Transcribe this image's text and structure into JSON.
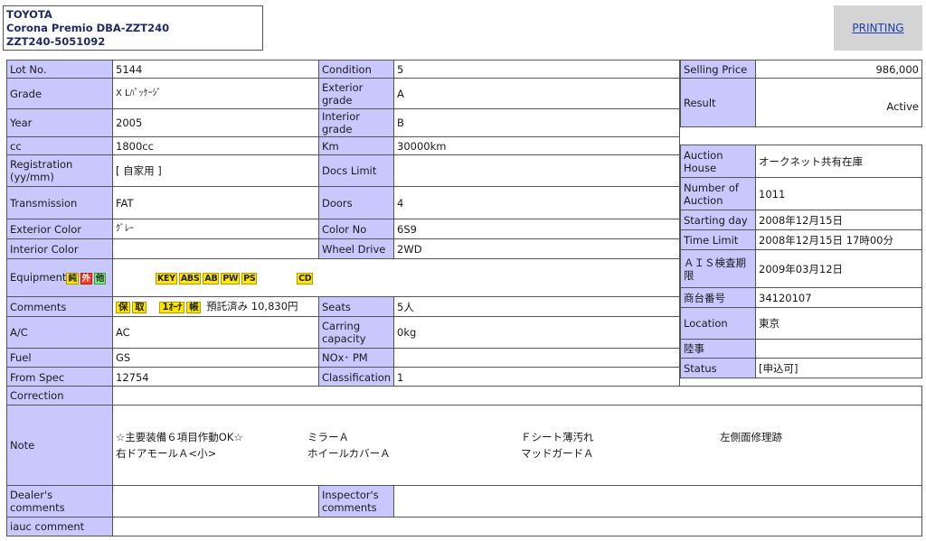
{
  "header": {
    "make": "TOYOTA",
    "model": "Corona Premio DBA-ZZT240",
    "chassis": "ZZT240-5051092",
    "print_label": "PRINTING"
  },
  "vehicle": {
    "lot_no": {
      "label": "Lot No.",
      "value": "5144"
    },
    "grade": {
      "label": "Grade",
      "value": "X Lﾊﾟｯｹｰｼﾞ"
    },
    "year": {
      "label": "Year",
      "value": "2005"
    },
    "cc": {
      "label": "cc",
      "value": "1800cc"
    },
    "registration": {
      "label": "Registration (yy/mm)",
      "value": "[ 自家用 ]"
    },
    "transmission": {
      "label": "Transmission",
      "value": "FAT"
    },
    "exterior_color": {
      "label": "Exterior Color",
      "value": "ｸﾞﾚｰ"
    },
    "interior_color": {
      "label": "Interior Color",
      "value": ""
    },
    "equipment": {
      "label": "Equipment",
      "type_tags": [
        "純",
        "外",
        "他"
      ],
      "tags": [
        "KEY",
        "ABS",
        "AB",
        "PW",
        "PS"
      ],
      "extra_tag": "CD"
    },
    "comments": {
      "label": "Comments",
      "tags": [
        "保",
        "取",
        "1ｵｰﾅ",
        "帳"
      ],
      "text": "預託済み 10,830円"
    },
    "ac": {
      "label": "A/C",
      "value": "AC"
    },
    "fuel": {
      "label": "Fuel",
      "value": "GS"
    },
    "from_spec": {
      "label": "From Spec",
      "value": "12754"
    },
    "condition": {
      "label": "Condition",
      "value": "5"
    },
    "exterior_grade": {
      "label": "Exterior grade",
      "value": "A"
    },
    "interior_grade": {
      "label": "Interior grade",
      "value": "B"
    },
    "km": {
      "label": "Km",
      "value": "30000km"
    },
    "docs_limit": {
      "label": "Docs Limit",
      "value": ""
    },
    "doors": {
      "label": "Doors",
      "value": "4"
    },
    "color_no": {
      "label": "Color No",
      "value": "6S9"
    },
    "wheel_drive": {
      "label": "Wheel Drive",
      "value": "2WD"
    },
    "seats": {
      "label": "Seats",
      "value": "5人"
    },
    "carrying_capacity": {
      "label": "Carring capacity",
      "value": "0kg"
    },
    "nox_pm": {
      "label": "NOx･ PM",
      "value": ""
    },
    "classification": {
      "label": "Classification",
      "value": "1"
    }
  },
  "price": {
    "selling_price": {
      "label": "Selling Price",
      "value": "986,000"
    },
    "result": {
      "label": "Result",
      "value": "Active"
    }
  },
  "auction": {
    "house": {
      "label": "Auction House",
      "value": "オークネット共有在庫"
    },
    "number": {
      "label": "Number of Auction",
      "value": "1011"
    },
    "starting_day": {
      "label": "Starting day",
      "value": "2008年12月15日"
    },
    "time_limit": {
      "label": "Time Limit",
      "value": "2008年12月15日 17時00分"
    },
    "ais": {
      "label": "ＡＩＳ検査期限",
      "value": "2009年03月12日"
    },
    "shodai": {
      "label": "商台番号",
      "value": "34120107"
    },
    "location": {
      "label": "Location",
      "value": "東京"
    },
    "rikuji": {
      "label": "陸事",
      "value": ""
    },
    "status": {
      "label": "Status",
      "value": "[申込可]"
    }
  },
  "notes": {
    "correction": {
      "label": "Correction",
      "value": ""
    },
    "note": {
      "label": "Note",
      "items": [
        "☆主要装備６項目作動OK☆",
        "ミラーＡ",
        "Ｆシート薄汚れ",
        "左側面修理跡",
        "右ドアモールＡ<小>",
        "ホイールカバーＡ",
        "マッドガードＡ"
      ]
    },
    "dealers_comments": {
      "label": "Dealer's comments",
      "value": ""
    },
    "inspectors_comments": {
      "label": "Inspector's comments",
      "value": ""
    },
    "iauc_comment": {
      "label": "iauc comment",
      "value": ""
    }
  }
}
